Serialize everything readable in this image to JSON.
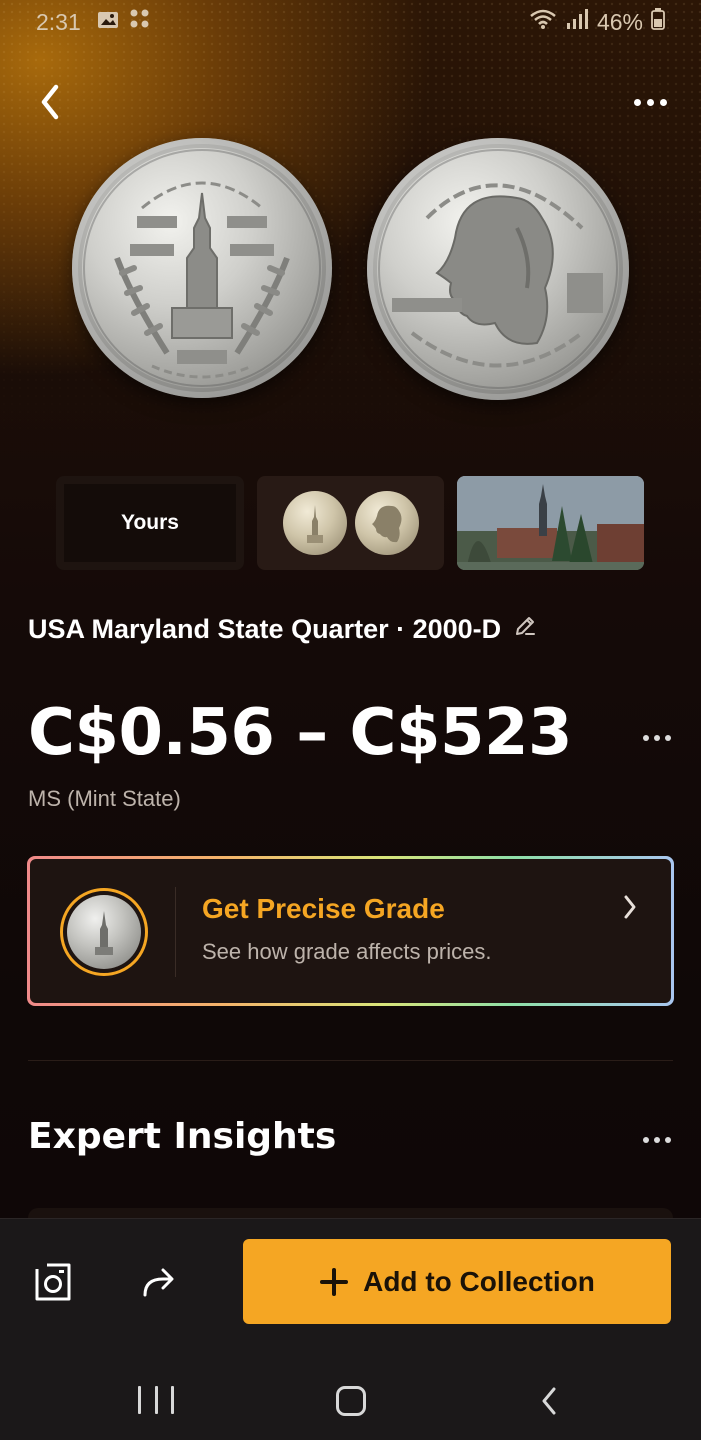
{
  "status_bar": {
    "time": "2:31",
    "battery": "46%",
    "icons": [
      "gallery-icon",
      "apps-icon",
      "wifi-icon",
      "signal-icon",
      "battery-icon"
    ]
  },
  "header": {
    "back_icon": "chevron-left-icon",
    "more_icon": "more-horizontal-icon"
  },
  "coin_images": {
    "front_icon": "maryland-quarter-obverse",
    "back_icon": "washington-quarter-reverse"
  },
  "thumbnails": {
    "yours_label": "Yours"
  },
  "coin": {
    "title": "USA Maryland State Quarter · 2000-D",
    "edit_icon": "pencil-icon",
    "price_range": "C$0.56 – C$523",
    "grade_label": "MS (Mint State)"
  },
  "grade_card": {
    "title": "Get Precise Grade",
    "subtitle": "See how grade affects prices.",
    "title_color": "#f5a623"
  },
  "insights": {
    "title": "Expert Insights"
  },
  "bottom_bar": {
    "add_label": "Add to Collection",
    "accent": "#f5a623"
  }
}
